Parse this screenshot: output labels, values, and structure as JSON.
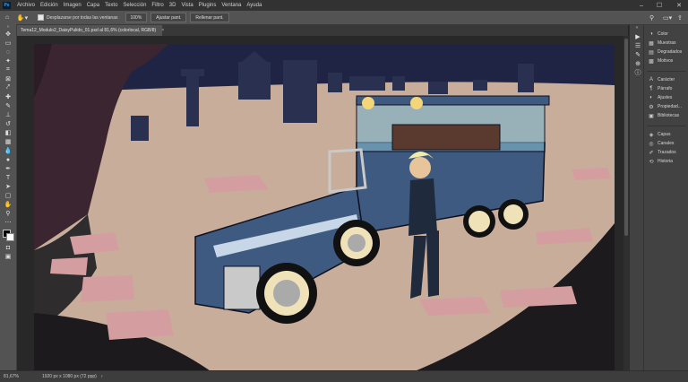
{
  "app": {
    "logo": "Ps"
  },
  "menu": [
    "Archivo",
    "Edición",
    "Imagen",
    "Capa",
    "Texto",
    "Selección",
    "Filtro",
    "3D",
    "Vista",
    "Plugins",
    "Ventana",
    "Ayuda"
  ],
  "window_controls": {
    "minimize": "–",
    "maximize": "☐",
    "close": "✕"
  },
  "options": {
    "scroll_all_label": "Desplazarse por todas las ventanas",
    "scroll_all_checked": true,
    "zoom_value": "100%",
    "fit_screen": "Ajustar pant.",
    "fill_screen": "Rellenar pant."
  },
  "tools": [
    {
      "name": "move-tool",
      "glyph": "✥"
    },
    {
      "name": "artboard-tool",
      "glyph": "▭"
    },
    {
      "name": "lasso-tool",
      "glyph": "◌"
    },
    {
      "name": "magic-wand-tool",
      "glyph": "✦"
    },
    {
      "name": "crop-tool",
      "glyph": "⌗"
    },
    {
      "name": "frame-tool",
      "glyph": "⊠"
    },
    {
      "name": "eyedropper-tool",
      "glyph": "⤤"
    },
    {
      "name": "healing-brush-tool",
      "glyph": "✚"
    },
    {
      "name": "brush-tool",
      "glyph": "✎"
    },
    {
      "name": "clone-stamp-tool",
      "glyph": "⊥"
    },
    {
      "name": "history-brush-tool",
      "glyph": "↺"
    },
    {
      "name": "eraser-tool",
      "glyph": "◧"
    },
    {
      "name": "gradient-tool",
      "glyph": "▦"
    },
    {
      "name": "blur-tool",
      "glyph": "💧"
    },
    {
      "name": "dodge-tool",
      "glyph": "●"
    },
    {
      "name": "pen-tool",
      "glyph": "✒"
    },
    {
      "name": "type-tool",
      "glyph": "T"
    },
    {
      "name": "path-selection-tool",
      "glyph": "➤"
    },
    {
      "name": "rectangle-tool",
      "glyph": "▢"
    },
    {
      "name": "hand-tool",
      "glyph": "✋"
    },
    {
      "name": "zoom-tool",
      "glyph": "⚲"
    },
    {
      "name": "more-tools",
      "glyph": "⋯"
    }
  ],
  "document_tab": {
    "title": "Tema12_Modulo2_DaisyPulido_01.psd al 81,6% (colorlocal, RGB/8)",
    "close": "×"
  },
  "status": {
    "zoom": "81,67%",
    "info": "1920 px x 1080 px (72 ppp)",
    "arrow": "›"
  },
  "panels": [
    {
      "name": "color",
      "label": "Color",
      "icon": "◑"
    },
    {
      "name": "swatches",
      "label": "Muestras",
      "icon": "▦"
    },
    {
      "name": "gradients",
      "label": "Degradados",
      "icon": "▤"
    },
    {
      "name": "patterns",
      "label": "Motivos",
      "icon": "▩"
    },
    {
      "name": "character",
      "label": "Carácter",
      "icon": "A"
    },
    {
      "name": "paragraph",
      "label": "Párrafo",
      "icon": "¶"
    },
    {
      "name": "adjustments",
      "label": "Ajustes",
      "icon": "◐"
    },
    {
      "name": "properties",
      "label": "Propiedad...",
      "icon": "⚙"
    },
    {
      "name": "libraries",
      "label": "Bibliotecas",
      "icon": "▣"
    },
    {
      "name": "layers",
      "label": "Capas",
      "icon": "◈"
    },
    {
      "name": "channels",
      "label": "Canales",
      "icon": "◎"
    },
    {
      "name": "paths",
      "label": "Trazados",
      "icon": "✐"
    },
    {
      "name": "history",
      "label": "Historia",
      "icon": "⟲"
    }
  ],
  "colors": {
    "foreground": "#000000",
    "background": "#ffffff",
    "accent": "#31a8ff"
  }
}
